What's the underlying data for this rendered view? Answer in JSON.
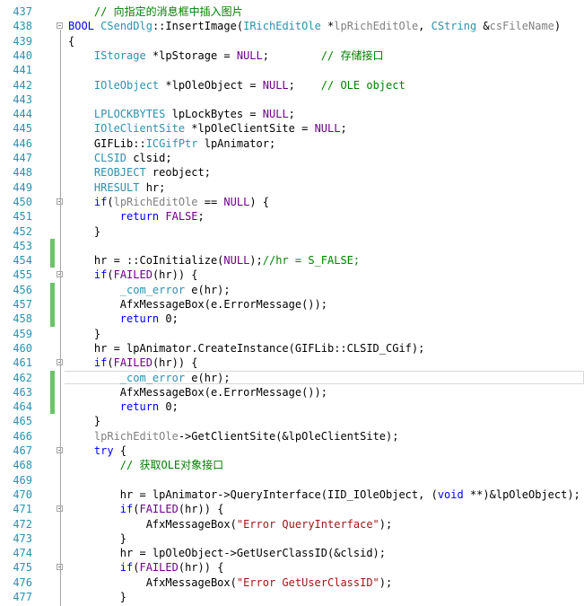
{
  "editor": {
    "lines": [
      {
        "num": "437",
        "tokens": [
          {
            "c": "c",
            "t": "    // 向指定的消息框中插入图片"
          }
        ]
      },
      {
        "num": "438",
        "fold": true,
        "tokens": [
          {
            "c": "k",
            "t": "BOOL"
          },
          {
            "c": "v",
            "t": " "
          },
          {
            "c": "t",
            "t": "CSendDlg"
          },
          {
            "c": "v",
            "t": "::InsertImage("
          },
          {
            "c": "t",
            "t": "IRichEditOle"
          },
          {
            "c": "v",
            "t": " *"
          },
          {
            "c": "p",
            "t": "lpRichEditOle"
          },
          {
            "c": "v",
            "t": ", "
          },
          {
            "c": "t",
            "t": "CString"
          },
          {
            "c": "v",
            "t": " &"
          },
          {
            "c": "p",
            "t": "csFileName"
          },
          {
            "c": "v",
            "t": ")"
          }
        ]
      },
      {
        "num": "439",
        "tokens": [
          {
            "c": "v",
            "t": "{"
          }
        ]
      },
      {
        "num": "440",
        "tokens": [
          {
            "c": "v",
            "t": "    "
          },
          {
            "c": "t",
            "t": "IStorage"
          },
          {
            "c": "v",
            "t": " *lpStorage = "
          },
          {
            "c": "m",
            "t": "NULL"
          },
          {
            "c": "v",
            "t": ";        "
          },
          {
            "c": "c",
            "t": "// 存储接口"
          }
        ]
      },
      {
        "num": "441",
        "tokens": []
      },
      {
        "num": "442",
        "tokens": [
          {
            "c": "v",
            "t": "    "
          },
          {
            "c": "t",
            "t": "IOleObject"
          },
          {
            "c": "v",
            "t": " *lpOleObject = "
          },
          {
            "c": "m",
            "t": "NULL"
          },
          {
            "c": "v",
            "t": ";    "
          },
          {
            "c": "c",
            "t": "// OLE object"
          }
        ]
      },
      {
        "num": "443",
        "tokens": []
      },
      {
        "num": "444",
        "tokens": [
          {
            "c": "v",
            "t": "    "
          },
          {
            "c": "t",
            "t": "LPLOCKBYTES"
          },
          {
            "c": "v",
            "t": " lpLockBytes = "
          },
          {
            "c": "m",
            "t": "NULL"
          },
          {
            "c": "v",
            "t": ";"
          }
        ]
      },
      {
        "num": "445",
        "tokens": [
          {
            "c": "v",
            "t": "    "
          },
          {
            "c": "t",
            "t": "IOleClientSite"
          },
          {
            "c": "v",
            "t": " *lpOleClientSite = "
          },
          {
            "c": "m",
            "t": "NULL"
          },
          {
            "c": "v",
            "t": ";"
          }
        ]
      },
      {
        "num": "446",
        "tokens": [
          {
            "c": "v",
            "t": "    GIFLib::"
          },
          {
            "c": "t",
            "t": "ICGifPtr"
          },
          {
            "c": "v",
            "t": " lpAnimator;"
          }
        ]
      },
      {
        "num": "447",
        "tokens": [
          {
            "c": "v",
            "t": "    "
          },
          {
            "c": "t",
            "t": "CLSID"
          },
          {
            "c": "v",
            "t": " clsid;"
          }
        ]
      },
      {
        "num": "448",
        "tokens": [
          {
            "c": "v",
            "t": "    "
          },
          {
            "c": "t",
            "t": "REOBJECT"
          },
          {
            "c": "v",
            "t": " reobject;"
          }
        ]
      },
      {
        "num": "449",
        "tokens": [
          {
            "c": "v",
            "t": "    "
          },
          {
            "c": "t",
            "t": "HRESULT"
          },
          {
            "c": "v",
            "t": " hr;"
          }
        ]
      },
      {
        "num": "450",
        "fold": true,
        "tokens": [
          {
            "c": "v",
            "t": "    "
          },
          {
            "c": "k",
            "t": "if"
          },
          {
            "c": "v",
            "t": "("
          },
          {
            "c": "p",
            "t": "lpRichEditOle"
          },
          {
            "c": "v",
            "t": " == "
          },
          {
            "c": "m",
            "t": "NULL"
          },
          {
            "c": "v",
            "t": ") {"
          }
        ]
      },
      {
        "num": "451",
        "tokens": [
          {
            "c": "v",
            "t": "        "
          },
          {
            "c": "k",
            "t": "return"
          },
          {
            "c": "v",
            "t": " "
          },
          {
            "c": "m",
            "t": "FALSE"
          },
          {
            "c": "v",
            "t": ";"
          }
        ]
      },
      {
        "num": "452",
        "tokens": [
          {
            "c": "v",
            "t": "    }"
          }
        ]
      },
      {
        "num": "453",
        "change": true,
        "tokens": []
      },
      {
        "num": "454",
        "change": true,
        "tokens": [
          {
            "c": "v",
            "t": "    hr = ::CoInitialize("
          },
          {
            "c": "m",
            "t": "NULL"
          },
          {
            "c": "v",
            "t": ");"
          },
          {
            "c": "c",
            "t": "//hr = S_FALSE;"
          }
        ]
      },
      {
        "num": "455",
        "fold": true,
        "tokens": [
          {
            "c": "v",
            "t": "    "
          },
          {
            "c": "k",
            "t": "if"
          },
          {
            "c": "v",
            "t": "("
          },
          {
            "c": "m",
            "t": "FAILED"
          },
          {
            "c": "v",
            "t": "(hr)) {"
          }
        ]
      },
      {
        "num": "456",
        "change": true,
        "tokens": [
          {
            "c": "v",
            "t": "        "
          },
          {
            "c": "t",
            "t": "_com_error"
          },
          {
            "c": "v",
            "t": " e(hr);"
          }
        ]
      },
      {
        "num": "457",
        "change": true,
        "tokens": [
          {
            "c": "v",
            "t": "        AfxMessageBox(e.ErrorMessage());"
          }
        ]
      },
      {
        "num": "458",
        "change": true,
        "tokens": [
          {
            "c": "v",
            "t": "        "
          },
          {
            "c": "k",
            "t": "return"
          },
          {
            "c": "v",
            "t": " 0;"
          }
        ]
      },
      {
        "num": "459",
        "tokens": [
          {
            "c": "v",
            "t": "    }"
          }
        ]
      },
      {
        "num": "460",
        "tokens": [
          {
            "c": "v",
            "t": "    hr = lpAnimator.CreateInstance(GIFLib::CLSID_CGif);"
          }
        ]
      },
      {
        "num": "461",
        "fold": true,
        "tokens": [
          {
            "c": "v",
            "t": "    "
          },
          {
            "c": "k",
            "t": "if"
          },
          {
            "c": "v",
            "t": "("
          },
          {
            "c": "m",
            "t": "FAILED"
          },
          {
            "c": "v",
            "t": "(hr)) {"
          }
        ]
      },
      {
        "num": "462",
        "change": true,
        "caret": true,
        "tokens": [
          {
            "c": "v",
            "t": "        "
          },
          {
            "c": "t",
            "t": "_com_error"
          },
          {
            "c": "v",
            "t": " e(hr);"
          }
        ]
      },
      {
        "num": "463",
        "change": true,
        "tokens": [
          {
            "c": "v",
            "t": "        AfxMessageBox(e.ErrorMessage());"
          }
        ]
      },
      {
        "num": "464",
        "change": true,
        "tokens": [
          {
            "c": "v",
            "t": "        "
          },
          {
            "c": "k",
            "t": "return"
          },
          {
            "c": "v",
            "t": " 0;"
          }
        ]
      },
      {
        "num": "465",
        "tokens": [
          {
            "c": "v",
            "t": "    }"
          }
        ]
      },
      {
        "num": "466",
        "tokens": [
          {
            "c": "v",
            "t": "    "
          },
          {
            "c": "p",
            "t": "lpRichEditOle"
          },
          {
            "c": "v",
            "t": "->GetClientSite(&lpOleClientSite);"
          }
        ]
      },
      {
        "num": "467",
        "fold": true,
        "tokens": [
          {
            "c": "v",
            "t": "    "
          },
          {
            "c": "k",
            "t": "try"
          },
          {
            "c": "v",
            "t": " {"
          }
        ]
      },
      {
        "num": "468",
        "tokens": [
          {
            "c": "v",
            "t": "        "
          },
          {
            "c": "c",
            "t": "// 获取OLE对象接口"
          }
        ]
      },
      {
        "num": "469",
        "tokens": []
      },
      {
        "num": "470",
        "tokens": [
          {
            "c": "v",
            "t": "        hr = lpAnimator->QueryInterface(IID_IOleObject, ("
          },
          {
            "c": "k",
            "t": "void"
          },
          {
            "c": "v",
            "t": " **)&lpOleObject);"
          }
        ]
      },
      {
        "num": "471",
        "fold": true,
        "tokens": [
          {
            "c": "v",
            "t": "        "
          },
          {
            "c": "k",
            "t": "if"
          },
          {
            "c": "v",
            "t": "("
          },
          {
            "c": "m",
            "t": "FAILED"
          },
          {
            "c": "v",
            "t": "(hr)) {"
          }
        ]
      },
      {
        "num": "472",
        "tokens": [
          {
            "c": "v",
            "t": "            AfxMessageBox("
          },
          {
            "c": "s",
            "t": "\"Error QueryInterface\""
          },
          {
            "c": "v",
            "t": ");"
          }
        ]
      },
      {
        "num": "473",
        "tokens": [
          {
            "c": "v",
            "t": "        }"
          }
        ]
      },
      {
        "num": "474",
        "tokens": [
          {
            "c": "v",
            "t": "        hr = lpOleObject->GetUserClassID(&clsid);"
          }
        ]
      },
      {
        "num": "475",
        "fold": true,
        "tokens": [
          {
            "c": "v",
            "t": "        "
          },
          {
            "c": "k",
            "t": "if"
          },
          {
            "c": "v",
            "t": "("
          },
          {
            "c": "m",
            "t": "FAILED"
          },
          {
            "c": "v",
            "t": "(hr)) {"
          }
        ]
      },
      {
        "num": "476",
        "tokens": [
          {
            "c": "v",
            "t": "            AfxMessageBox("
          },
          {
            "c": "s",
            "t": "\"Error GetUserClassID\""
          },
          {
            "c": "v",
            "t": ");"
          }
        ]
      },
      {
        "num": "477",
        "tokens": [
          {
            "c": "v",
            "t": "        }"
          }
        ]
      }
    ]
  }
}
